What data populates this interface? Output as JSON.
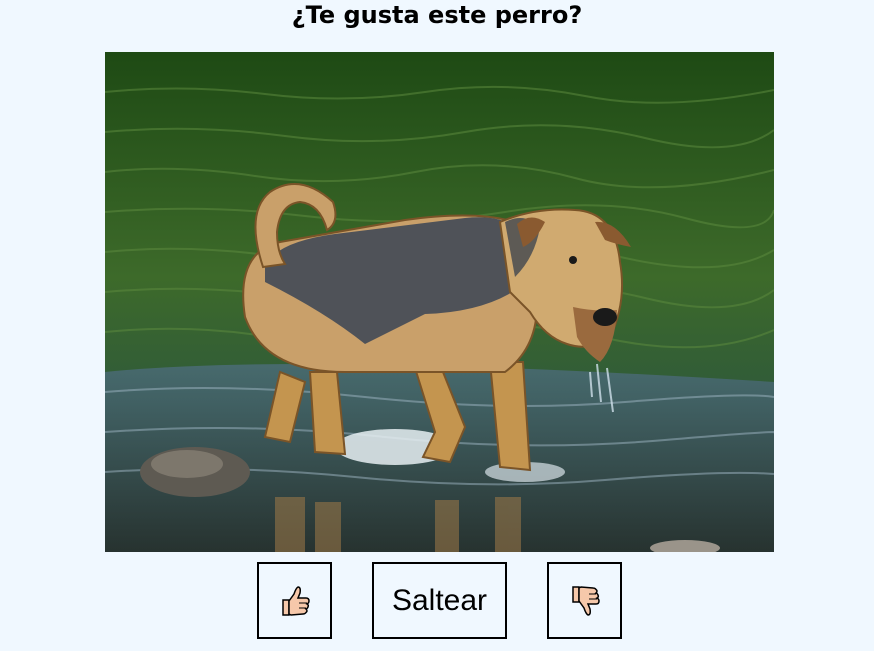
{
  "page": {
    "title": "¿Te gusta este perro?"
  },
  "buttons": {
    "like_icon": "thumbs-up-icon",
    "skip_label": "Saltear",
    "dislike_icon": "thumbs-down-icon"
  },
  "colors": {
    "background": "#f0f8ff",
    "border": "#000000",
    "thumb_fill": "#f6c8aa"
  }
}
